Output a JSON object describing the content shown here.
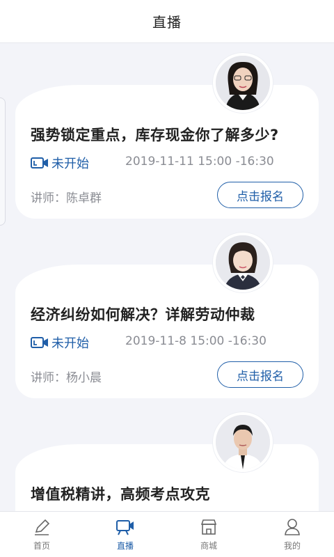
{
  "header": {
    "title": "直播"
  },
  "lectures": [
    {
      "title": "强势锁定重点，库存现金你了解多少?",
      "status": "未开始",
      "time": "2019-11-11 15:00 -16:30",
      "lecturer": "讲师：陈卓群",
      "button": "点击报名"
    },
    {
      "title": "经济纠纷如何解决？详解劳动仲裁",
      "status": "未开始",
      "time": "2019-11-8 15:00 -16:30",
      "lecturer": "讲师：杨小晨",
      "button": "点击报名"
    },
    {
      "title": "增值税精讲，高频考点攻克"
    }
  ],
  "tabs": [
    {
      "label": "首页",
      "icon": "pencil-icon"
    },
    {
      "label": "直播",
      "icon": "video-screen-icon"
    },
    {
      "label": "商城",
      "icon": "store-icon"
    },
    {
      "label": "我的",
      "icon": "person-icon"
    }
  ],
  "colors": {
    "accent": "#1f5ea8",
    "background": "#f3f4f9"
  }
}
